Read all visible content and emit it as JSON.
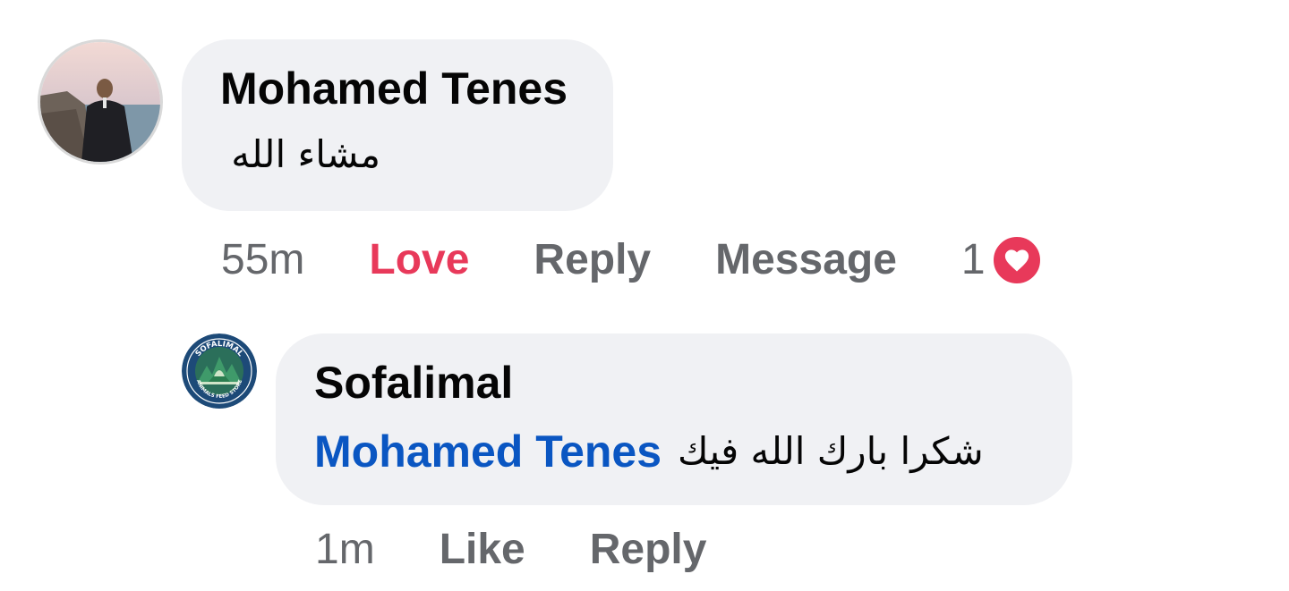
{
  "comment": {
    "author": "Mohamed Tenes",
    "text": "مشاء الله",
    "timestamp": "55m",
    "actions": {
      "love": "Love",
      "reply": "Reply",
      "message": "Message"
    },
    "reaction_count": "1",
    "reaction_icon": "heart-icon"
  },
  "reply": {
    "author": "Sofalimal",
    "mention": "Mohamed Tenes",
    "text": "شكرا بارك الله فيك",
    "timestamp": "1m",
    "actions": {
      "like": "Like",
      "reply": "Reply"
    },
    "avatar_logo_text_top": "SOFALIMAL",
    "avatar_logo_text_bottom": "ANIMALS FEED STORE"
  },
  "colors": {
    "love": "#e8395a",
    "mention": "#0a56c2",
    "bubble": "#f0f1f4",
    "secondary_text": "#65676b"
  }
}
